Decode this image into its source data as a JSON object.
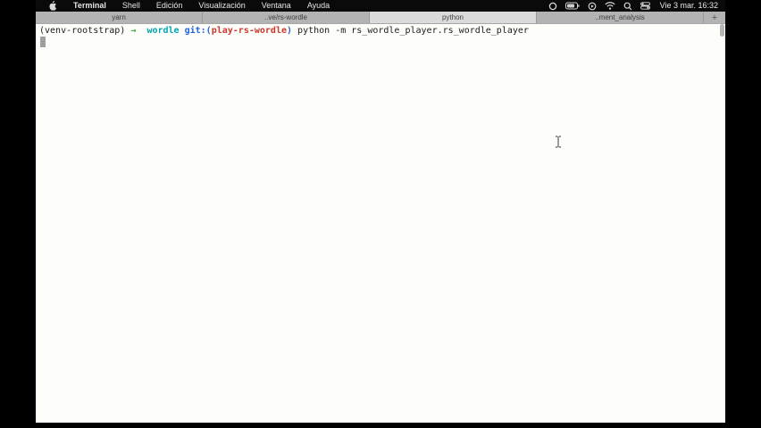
{
  "menu_bar": {
    "items": [
      "Terminal",
      "Shell",
      "Edición",
      "Visualización",
      "Ventana",
      "Ayuda"
    ],
    "icons": [
      "focus-circle-icon",
      "battery-icon",
      "play-circle-icon",
      "wifi-icon",
      "spotlight-search-icon",
      "control-center-icon"
    ],
    "clock": "Vie 3 mar. 16:32"
  },
  "tab_bar": {
    "tabs": [
      "yarn",
      "..ve/rs-wordle",
      "python",
      "..ment_analysis"
    ],
    "active_tab": "python",
    "new_tab_label": "+"
  },
  "terminal": {
    "prompt": {
      "venv": "(venv-rootstrap) ",
      "arrow": "→",
      "gap": "  ",
      "directory": "wordle",
      "space": " ",
      "git_prefix": "git:(",
      "git_branch": "play-rs-wordle",
      "git_close": ")",
      "command": " python -m rs_wordle_player.rs_wordle_player"
    }
  },
  "colors": {
    "menubar_bg": "#0a0a0a",
    "tab_inactive": "#b3b3b3",
    "tab_active": "#dadada",
    "terminal_bg": "#fdfdfa",
    "arrow_green": "#3fa33f",
    "directory_cyan": "#00a6b2",
    "git_blue": "#2563d9",
    "branch_red": "#cc372e",
    "text_black": "#1c1c1c",
    "cursor_gray": "#9f9f9f"
  }
}
